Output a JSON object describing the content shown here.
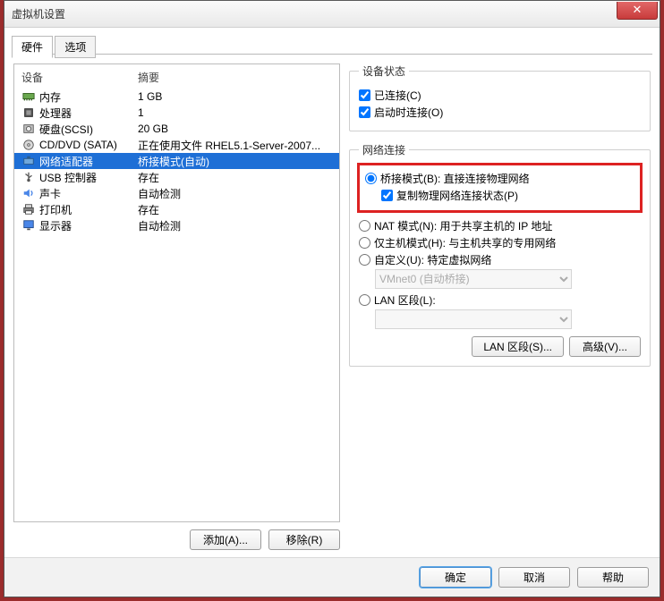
{
  "window": {
    "title": "虚拟机设置"
  },
  "tabs": {
    "hardware": "硬件",
    "options": "选项"
  },
  "list": {
    "header": {
      "device": "设备",
      "summary": "摘要"
    },
    "rows": [
      {
        "icon": "memory-icon",
        "device": "内存",
        "summary": "1 GB"
      },
      {
        "icon": "cpu-icon",
        "device": "处理器",
        "summary": "1"
      },
      {
        "icon": "disk-icon",
        "device": "硬盘(SCSI)",
        "summary": "20 GB"
      },
      {
        "icon": "cd-icon",
        "device": "CD/DVD (SATA)",
        "summary": "正在使用文件 RHEL5.1-Server-2007..."
      },
      {
        "icon": "network-icon",
        "device": "网络适配器",
        "summary": "桥接模式(自动)"
      },
      {
        "icon": "usb-icon",
        "device": "USB 控制器",
        "summary": "存在"
      },
      {
        "icon": "sound-icon",
        "device": "声卡",
        "summary": "自动检测"
      },
      {
        "icon": "printer-icon",
        "device": "打印机",
        "summary": "存在"
      },
      {
        "icon": "display-icon",
        "device": "显示器",
        "summary": "自动检测"
      }
    ],
    "selected_index": 4
  },
  "left_buttons": {
    "add": "添加(A)...",
    "remove": "移除(R)"
  },
  "device_status": {
    "legend": "设备状态",
    "connected": "已连接(C)",
    "connect_at_power_on": "启动时连接(O)"
  },
  "network": {
    "legend": "网络连接",
    "bridged": "桥接模式(B): 直接连接物理网络",
    "replicate": "复制物理网络连接状态(P)",
    "nat": "NAT 模式(N): 用于共享主机的 IP 地址",
    "hostonly": "仅主机模式(H): 与主机共享的专用网络",
    "custom": "自定义(U): 特定虚拟网络",
    "custom_combo": "VMnet0 (自动桥接)",
    "lan_segment": "LAN 区段(L):",
    "btn_lan": "LAN 区段(S)...",
    "btn_adv": "高级(V)..."
  },
  "footer": {
    "ok": "确定",
    "cancel": "取消",
    "help": "帮助"
  }
}
